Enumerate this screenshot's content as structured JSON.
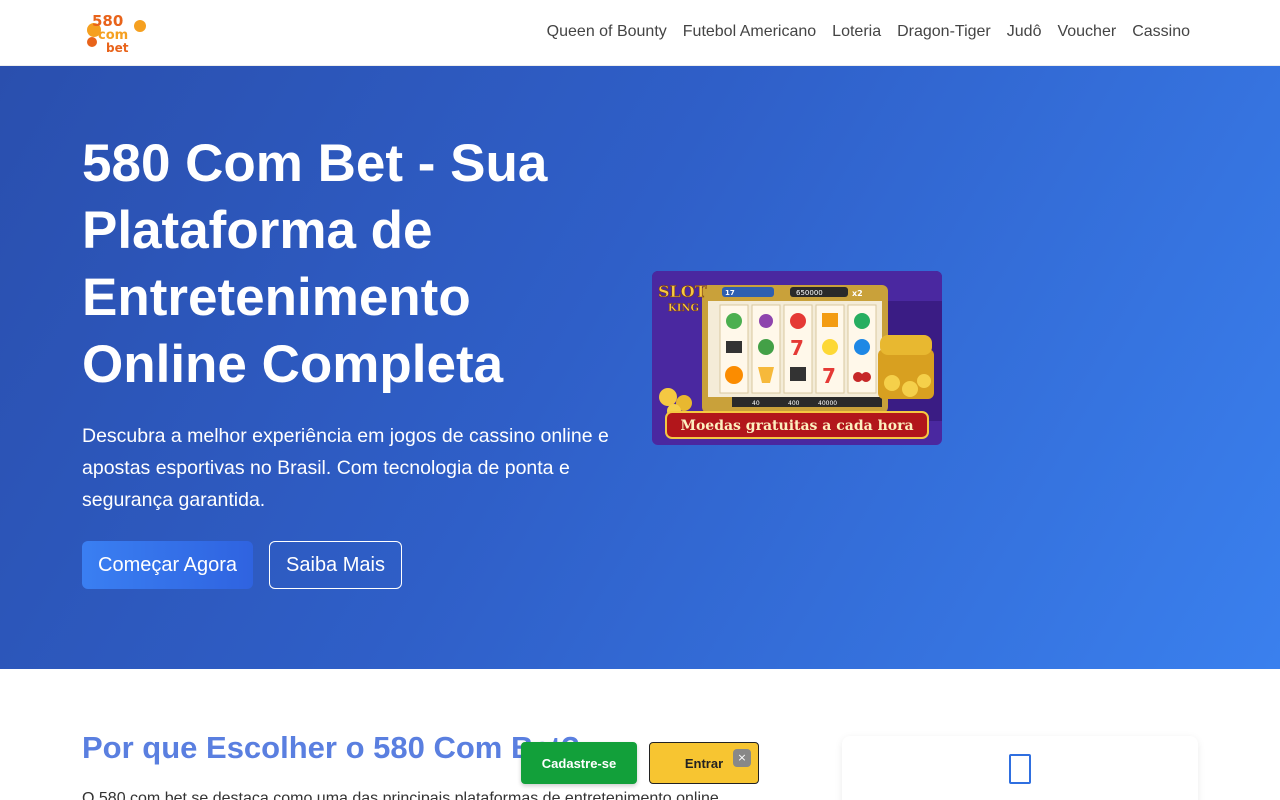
{
  "header": {
    "logo_text": [
      "580",
      "com",
      "bet"
    ],
    "nav": [
      {
        "label": "Queen of Bounty"
      },
      {
        "label": "Futebol Americano"
      },
      {
        "label": "Loteria"
      },
      {
        "label": "Dragon-Tiger"
      },
      {
        "label": "Judô"
      },
      {
        "label": "Voucher"
      },
      {
        "label": "Cassino"
      }
    ]
  },
  "hero": {
    "title": "580 Com Bet - Sua Plataforma de Entretenimento Online Completa",
    "description": "Descubra a melhor experiência em jogos de cassino online e apostas esportivas no Brasil. Com tecnologia de ponta e segurança garantida.",
    "primary_button": "Começar Agora",
    "secondary_button": "Saiba Mais",
    "game_image": {
      "logo_text": [
        "SLOT",
        "KING"
      ],
      "banner_text": "Moedas gratuitas a cada hora",
      "top_counter": "650000",
      "top_multiplier": "x2",
      "level": "17",
      "bottom_values": [
        "40",
        "400",
        "40000"
      ]
    }
  },
  "section": {
    "title": "Por que Escolher o 580 Com Bet?",
    "text": "O 580 com bet se destaca como uma das principais plataformas de entretenimento online"
  },
  "floating_bar": {
    "register_button": "Cadastre-se",
    "login_button": "Entrar",
    "close_label": "×"
  },
  "colors": {
    "hero_gradient_start": "#2a4fae",
    "hero_gradient_end": "#3a80ee",
    "register": "#12a03a",
    "login": "#f7c531",
    "section_title": "#5a7fe0"
  }
}
